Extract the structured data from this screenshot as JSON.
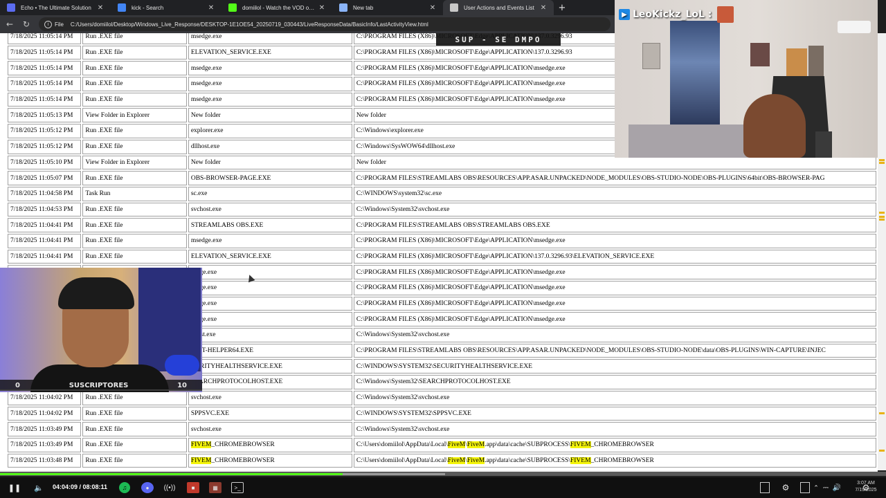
{
  "tabs": [
    {
      "label": "Echo • The Ultimate Solution",
      "icon": "echo-logo-icon",
      "color": "#5b6cf0"
    },
    {
      "label": "kick - Search",
      "icon": "google-g-icon",
      "color": "#4285f4"
    },
    {
      "label": "domiilol - Watch the VOD on Kick",
      "icon": "kick-icon",
      "color": "#53fc18"
    },
    {
      "label": "New tab",
      "icon": "newtab-icon",
      "color": "#8ab4f8"
    },
    {
      "label": "User Actions and Events List",
      "icon": "globe-icon",
      "color": "#c8c8c8",
      "active": true
    }
  ],
  "address": {
    "scheme": "File",
    "url": "C:/Users/domiilol/Desktop/Windows_Live_Response/DESKTOP-1E1OE54_20250719_030443/LiveResponseData/BasicInfo/LastActivityView.html"
  },
  "watermark": "SUP - SE DMPO",
  "events": [
    [
      "7/18/2025 11:05:14 PM",
      "Run .EXE file",
      "msedge.exe",
      "C:\\PROGRAM FILES (X86)\\MICROSOFT\\Edge\\APPLICATION\\137.0.3296.93"
    ],
    [
      "7/18/2025 11:05:14 PM",
      "Run .EXE file",
      "ELEVATION_SERVICE.EXE",
      "C:\\PROGRAM FILES (X86)\\MICROSOFT\\Edge\\APPLICATION\\137.0.3296.93"
    ],
    [
      "7/18/2025 11:05:14 PM",
      "Run .EXE file",
      "msedge.exe",
      "C:\\PROGRAM FILES (X86)\\MICROSOFT\\Edge\\APPLICATION\\msedge.exe"
    ],
    [
      "7/18/2025 11:05:14 PM",
      "Run .EXE file",
      "msedge.exe",
      "C:\\PROGRAM FILES (X86)\\MICROSOFT\\Edge\\APPLICATION\\msedge.exe"
    ],
    [
      "7/18/2025 11:05:14 PM",
      "Run .EXE file",
      "msedge.exe",
      "C:\\PROGRAM FILES (X86)\\MICROSOFT\\Edge\\APPLICATION\\msedge.exe"
    ],
    [
      "7/18/2025 11:05:13 PM",
      "View Folder in Explorer",
      "New folder",
      "New folder"
    ],
    [
      "7/18/2025 11:05:12 PM",
      "Run .EXE file",
      "explorer.exe",
      "C:\\Windows\\explorer.exe"
    ],
    [
      "7/18/2025 11:05:12 PM",
      "Run .EXE file",
      "dllhost.exe",
      "C:\\Windows\\SysWOW64\\dllhost.exe"
    ],
    [
      "7/18/2025 11:05:10 PM",
      "View Folder in Explorer",
      "New folder",
      "New folder"
    ],
    [
      "7/18/2025 11:05:07 PM",
      "Run .EXE file",
      "OBS-BROWSER-PAGE.EXE",
      "C:\\PROGRAM FILES\\STREAMLABS OBS\\RESOURCES\\APP.ASAR.UNPACKED\\NODE_MODULES\\OBS-STUDIO-NODE\\OBS-PLUGINS\\64bit\\OBS-BROWSER-PAG"
    ],
    [
      "7/18/2025 11:04:58 PM",
      "Task Run",
      "sc.exe",
      "C:\\WINDOWS\\system32\\sc.exe"
    ],
    [
      "7/18/2025 11:04:53 PM",
      "Run .EXE file",
      "svchost.exe",
      "C:\\Windows\\System32\\svchost.exe"
    ],
    [
      "7/18/2025 11:04:41 PM",
      "Run .EXE file",
      "STREAMLABS OBS.EXE",
      "C:\\PROGRAM FILES\\STREAMLABS OBS\\STREAMLABS OBS.EXE"
    ],
    [
      "7/18/2025 11:04:41 PM",
      "Run .EXE file",
      "msedge.exe",
      "C:\\PROGRAM FILES (X86)\\MICROSOFT\\Edge\\APPLICATION\\msedge.exe"
    ],
    [
      "7/18/2025 11:04:41 PM",
      "Run .EXE file",
      "ELEVATION_SERVICE.EXE",
      "C:\\PROGRAM FILES (X86)\\MICROSOFT\\Edge\\APPLICATION\\137.0.3296.93\\ELEVATION_SERVICE.EXE"
    ],
    [
      "",
      "",
      "sedge.exe",
      "C:\\PROGRAM FILES (X86)\\MICROSOFT\\Edge\\APPLICATION\\msedge.exe"
    ],
    [
      "",
      "",
      "sedge.exe",
      "C:\\PROGRAM FILES (X86)\\MICROSOFT\\Edge\\APPLICATION\\msedge.exe"
    ],
    [
      "",
      "",
      "sedge.exe",
      "C:\\PROGRAM FILES (X86)\\MICROSOFT\\Edge\\APPLICATION\\msedge.exe"
    ],
    [
      "",
      "",
      "sedge.exe",
      "C:\\PROGRAM FILES (X86)\\MICROSOFT\\Edge\\APPLICATION\\msedge.exe"
    ],
    [
      "",
      "",
      "chost.exe",
      "C:\\Windows\\System32\\svchost.exe"
    ],
    [
      "",
      "",
      "JECT-HELPER64.EXE",
      "C:\\PROGRAM FILES\\STREAMLABS OBS\\RESOURCES\\APP.ASAR.UNPACKED\\NODE_MODULES\\OBS-STUDIO-NODE\\data\\OBS-PLUGINS\\WIN-CAPTURE\\INJEC"
    ],
    [
      "",
      "",
      "CURITYHEALTHSERVICE.EXE",
      "C:\\WINDOWS\\SYSTEM32\\SECURITYHEALTHSERVICE.EXE"
    ],
    [
      "7/18/2025 11:04:04 PM",
      "Run .EXE file",
      "SEARCHPROTOCOLHOST.EXE",
      "C:\\Windows\\System32\\SEARCHPROTOCOLHOST.EXE"
    ],
    [
      "7/18/2025 11:04:02 PM",
      "Run .EXE file",
      "svchost.exe",
      "C:\\Windows\\System32\\svchost.exe"
    ],
    [
      "7/18/2025 11:04:02 PM",
      "Run .EXE file",
      "SPPSVC.EXE",
      "C:\\WINDOWS\\SYSTEM32\\SPPSVC.EXE"
    ],
    [
      "7/18/2025 11:03:49 PM",
      "Run .EXE file",
      "svchost.exe",
      "C:\\Windows\\System32\\svchost.exe"
    ],
    [
      "7/18/2025 11:03:49 PM",
      "Run .EXE file",
      "FIVEM_CHROMEBROWSER",
      "C:\\Users\\domiilol\\AppData\\Local\\FiveM\\FiveM.app\\data\\cache\\SUBPROCESS\\FIVEM_CHROMEBROWSER"
    ],
    [
      "7/18/2025 11:03:48 PM",
      "Run .EXE file",
      "FIVEM_CHROMEBROWSER",
      "C:\\Users\\domiilol\\AppData\\Local\\FiveM\\FiveM.app\\data\\cache\\SUBPROCESS\\FIVEM_CHROMEBROWSER"
    ]
  ],
  "highlight_terms": [
    "FIVEM",
    "FiveM"
  ],
  "highlight_color": "#f4f40a",
  "overlay": {
    "streamer_label": "LeoKickz_LoL :",
    "subs_left": "0",
    "subs_title": "SUSCRIPTORES",
    "subs_right": "10"
  },
  "player": {
    "timecode": "04:04:09 / 08:08:11",
    "progress_fraction": 0.387,
    "accent": "#53fc18"
  },
  "clock": {
    "time": "3:07 AM",
    "date": "7/19/2025"
  }
}
